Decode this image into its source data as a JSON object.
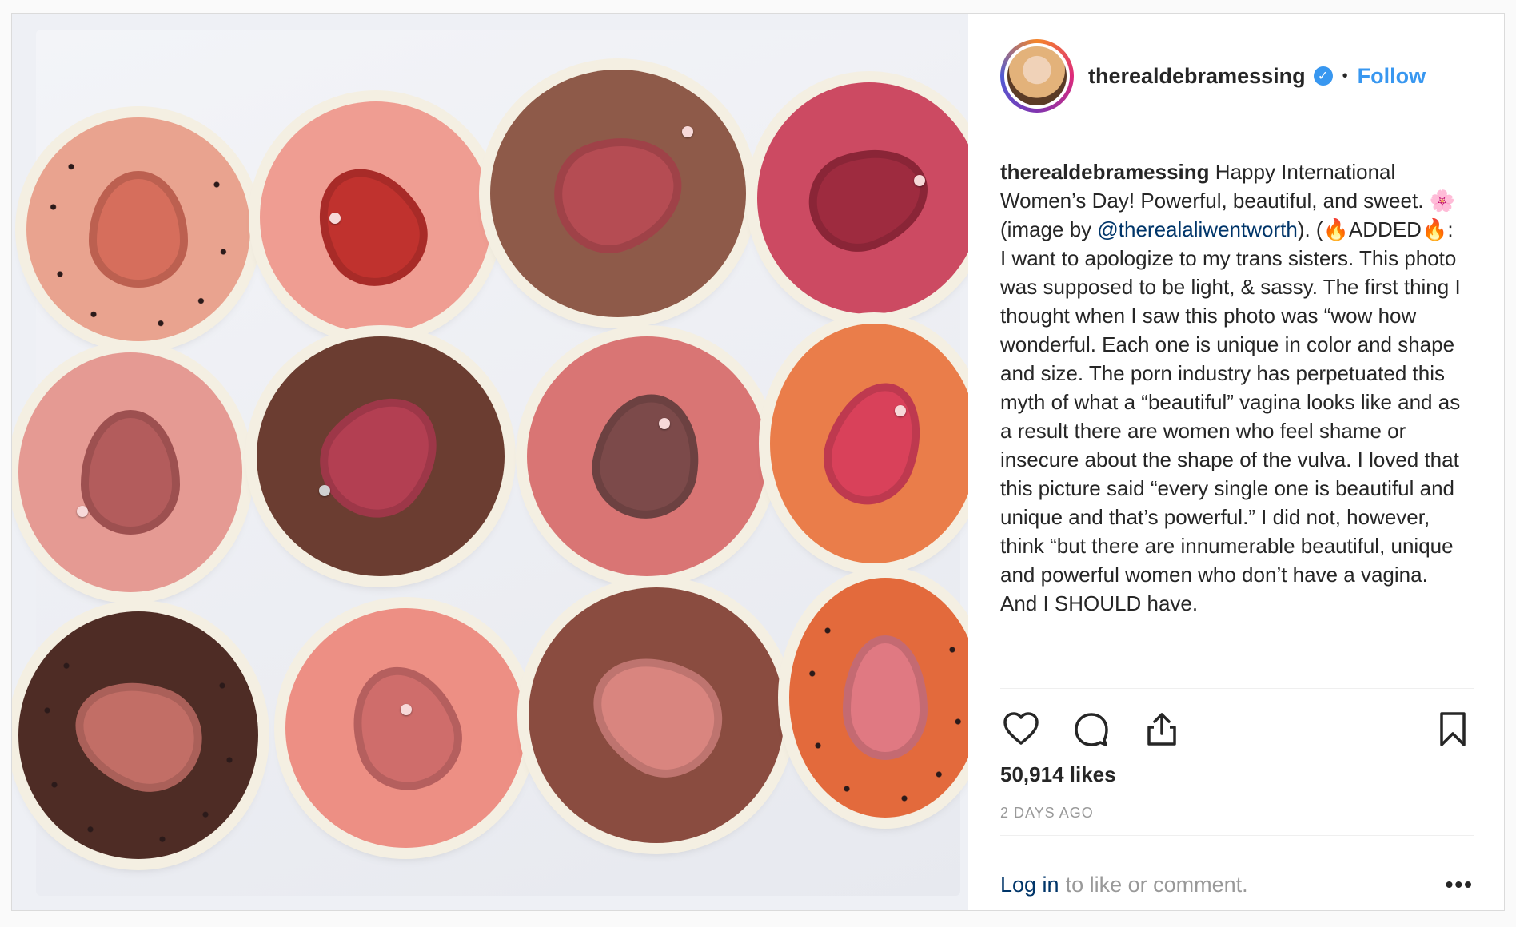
{
  "post": {
    "username": "therealdebramessing",
    "verified_icon": "verified-badge-icon",
    "separator": "•",
    "follow_label": "Follow",
    "caption": {
      "user": "therealdebramessing",
      "part1": "Happy International Women’s Day! Powerful, beautiful, and sweet. 🌸 (image by ",
      "mention": "@therealaliwentworth",
      "part2": "). (🔥ADDED🔥: I want to apologize to my trans sisters. This photo was supposed to be light, & sassy. The first thing I thought when I saw this photo was “wow how wonderful. Each one is unique in color and shape and size. The porn industry has perpetuated this myth of what a “beautiful” vagina looks like and as a result there are women who feel shame or insecure about the shape of the vulva. I loved that this picture said “every single one is beautiful and unique and that’s powerful.” I did not, however, think “but there are innumerable beautiful, unique and powerful women who don’t have a vagina. And I SHOULD have."
    },
    "likes": "50,914 likes",
    "date": "2 DAYS AGO",
    "footer": {
      "login": "Log in",
      "rest": "to like or comment.",
      "more": "•••"
    },
    "colors": {
      "accent": "#3897f0",
      "text": "#262626",
      "muted": "#999999",
      "link": "#003569"
    }
  }
}
